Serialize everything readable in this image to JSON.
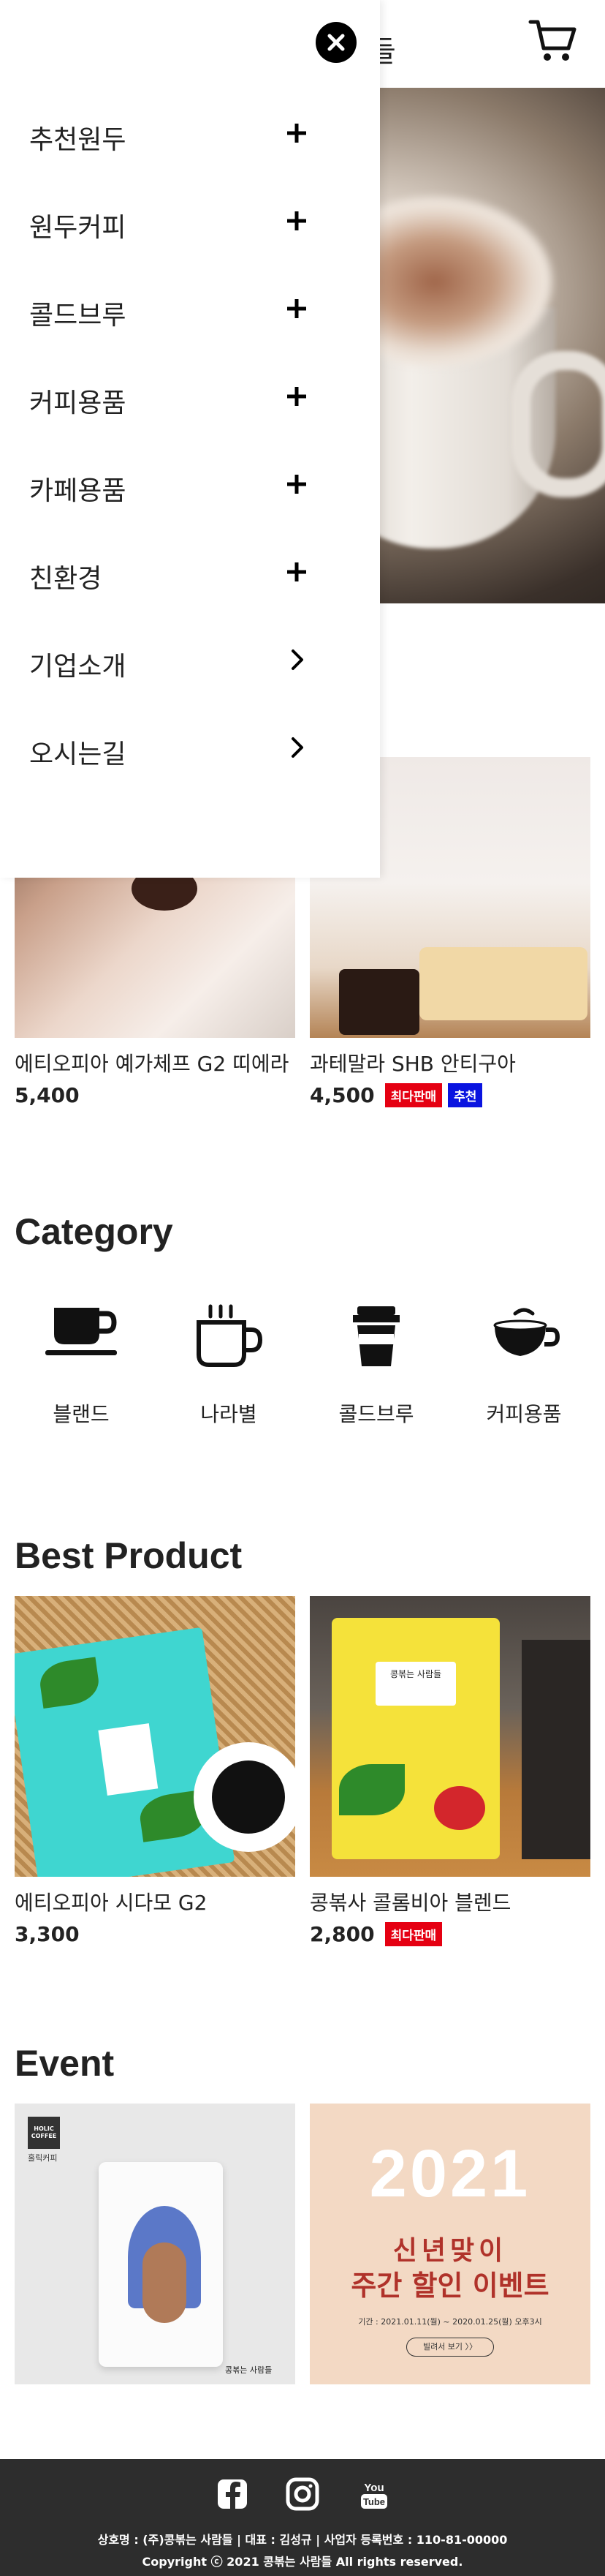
{
  "header": {
    "logo_text": "들"
  },
  "menu": {
    "items": [
      {
        "label": "추천원두",
        "icon": "plus-icon"
      },
      {
        "label": "원두커피",
        "icon": "plus-icon"
      },
      {
        "label": "콜드브루",
        "icon": "plus-icon"
      },
      {
        "label": "커피용품",
        "icon": "plus-icon"
      },
      {
        "label": "카페용품",
        "icon": "plus-icon"
      },
      {
        "label": "친환경",
        "icon": "plus-icon"
      },
      {
        "label": "기업소개",
        "icon": "chevron-right-icon"
      },
      {
        "label": "오시는길",
        "icon": "chevron-right-icon"
      }
    ]
  },
  "new_products": [
    {
      "name": "에티오피아 예가체프 G2 띠에라",
      "price": "5,400",
      "badges": []
    },
    {
      "name": "과테말라 SHB 안티구아",
      "price": "4,500",
      "badges": [
        "최다판매",
        "추천"
      ]
    }
  ],
  "category": {
    "title": "Category",
    "items": [
      {
        "label": "블랜드",
        "icon": "coffee-cup-icon"
      },
      {
        "label": "나라별",
        "icon": "steaming-mug-icon"
      },
      {
        "label": "콜드브루",
        "icon": "takeaway-cup-icon"
      },
      {
        "label": "커피용품",
        "icon": "latte-bowl-icon"
      }
    ]
  },
  "best": {
    "title": "Best Product",
    "items": [
      {
        "name": "에티오피아 시다모 G2",
        "price": "3,300",
        "badges": []
      },
      {
        "name": "콩볶사 콜롬비아 블렌드",
        "price": "2,800",
        "badges": [
          "최다판매"
        ]
      }
    ],
    "package_brand": "콩볶는 사람들"
  },
  "event": {
    "title": "Event",
    "brand_box_line1": "HOLIC",
    "brand_box_line2": "COFFEE",
    "brand_box_caption": "홀릭커피",
    "pack_brand": "콩볶는 사람들",
    "event_year": "2021",
    "event_title1": "신년맞이",
    "event_title2": "주간 할인 이벤트",
    "event_period": "기간 : 2021.01.11(월) ~ 2020.01.25(월) 오후3시",
    "event_button": "빌려서 보기 〉〉"
  },
  "footer": {
    "line1": "상호명 : (주)콩볶는 사람들  |  대표 : 김성규  |  사업자 등록번호 : 110-81-00000",
    "line2": "Copyright ⓒ 2021 콩볶는 사람들 All rights reserved.",
    "youtube_label": "You Tube"
  },
  "colors": {
    "badge_red": "#e50012",
    "badge_blue": "#0a14e0",
    "footer_bg": "#2d2d2d"
  }
}
